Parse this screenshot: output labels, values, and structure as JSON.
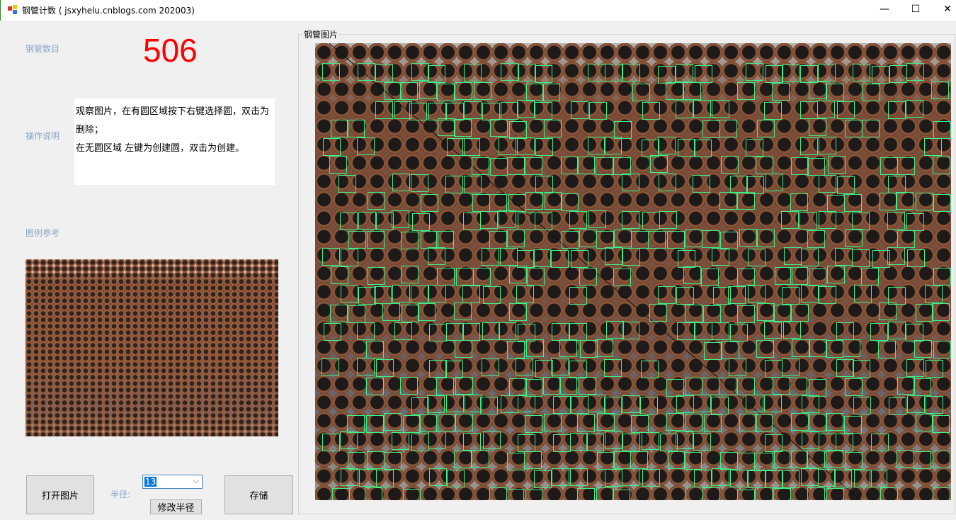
{
  "window": {
    "title": "钢管计数 ( jsxyhelu.cnblogs.com 202003)",
    "minimize": "—",
    "maximize": "☐",
    "close": "✕"
  },
  "left": {
    "count_label": "钢管数目",
    "count": "506",
    "instructions_label": "操作说明",
    "instructions": [
      "观察图片，在有圆区域按下右键选择圆，双击为删除；",
      "在无圆区域 左键为创建圆，双击为创建。"
    ],
    "reference_label": "图例参考"
  },
  "controls": {
    "open_button": "打开图片",
    "radius_label": "半径:",
    "radius_value": "13",
    "modify_radius_button": "修改半径",
    "save_button": "存储"
  },
  "group": {
    "title": "钢管图片"
  }
}
